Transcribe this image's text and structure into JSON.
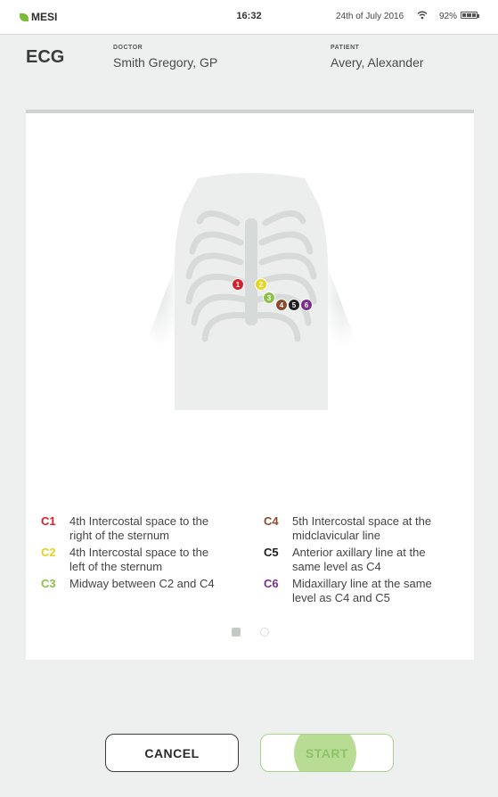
{
  "status_bar": {
    "carrier": "MESI",
    "time": "16:32",
    "date": "24th of July 2016",
    "battery_percent": "92%"
  },
  "header": {
    "title": "ECG",
    "doctor_label": "DOCTOR",
    "doctor_name": "Smith Gregory, GP",
    "patient_label": "PATIENT",
    "patient_name": "Avery, Alexander"
  },
  "diagram": {
    "electrodes": [
      {
        "num": "1",
        "color": "#d5212b"
      },
      {
        "num": "2",
        "color": "#e9d51e"
      },
      {
        "num": "3",
        "color": "#8cc04a"
      },
      {
        "num": "4",
        "color": "#8a4a2c"
      },
      {
        "num": "5",
        "color": "#1e1e1e"
      },
      {
        "num": "6",
        "color": "#7a2f8e"
      }
    ]
  },
  "legend": [
    {
      "code": "C1",
      "color": "#d5212b",
      "text": "4th Intercostal space to the right of the sternum"
    },
    {
      "code": "C2",
      "color": "#e6d020",
      "text": "4th Intercostal space to the left of the sternum"
    },
    {
      "code": "C3",
      "color": "#8cc04a",
      "text": "Midway between C2 and C4"
    },
    {
      "code": "C4",
      "color": "#8a4a2c",
      "text": "5th Intercostal space at the midclavicular line"
    },
    {
      "code": "C5",
      "color": "#1e1e1e",
      "text": "Anterior axillary line at the same level as C4"
    },
    {
      "code": "C6",
      "color": "#7a2f8e",
      "text": "Midaxillary line at the same level as C4 and C5"
    }
  ],
  "pagination": {
    "current_page": 1,
    "total_pages": 2
  },
  "actions": {
    "cancel_label": "CANCEL",
    "start_label": "START"
  }
}
